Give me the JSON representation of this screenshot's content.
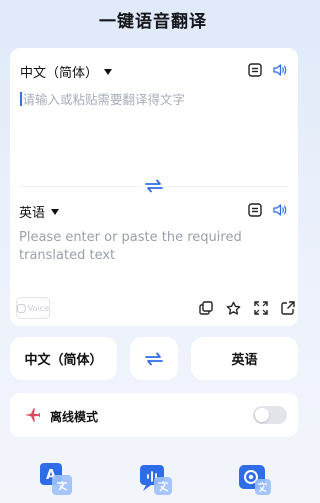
{
  "header": {
    "title": "一键语音翻译"
  },
  "source": {
    "language": "中文（简体）",
    "placeholder": "请输入或粘贴需要翻译得文字"
  },
  "target": {
    "language": "英语",
    "placeholder": "Please enter or paste the required translated text"
  },
  "badge": {
    "label": "Voice"
  },
  "bottom_selector": {
    "source_label": "中文（简体）",
    "target_label": "英语"
  },
  "offline": {
    "label": "离线模式",
    "enabled": false
  },
  "icons": {
    "source_actions": [
      "text-card-icon",
      "volume-icon"
    ],
    "swap": "swap-icon",
    "target_actions": [
      "text-card-icon",
      "volume-icon"
    ],
    "result_actions": [
      "copy-icon",
      "star-icon",
      "fullscreen-icon",
      "share-icon"
    ],
    "offline": "airplane-icon",
    "bottom_nav": [
      "text-translate-icon",
      "voice-translate-icon",
      "photo-translate-icon"
    ]
  },
  "colors": {
    "accent": "#2f6de8",
    "offline_icon": "#e0475a"
  }
}
